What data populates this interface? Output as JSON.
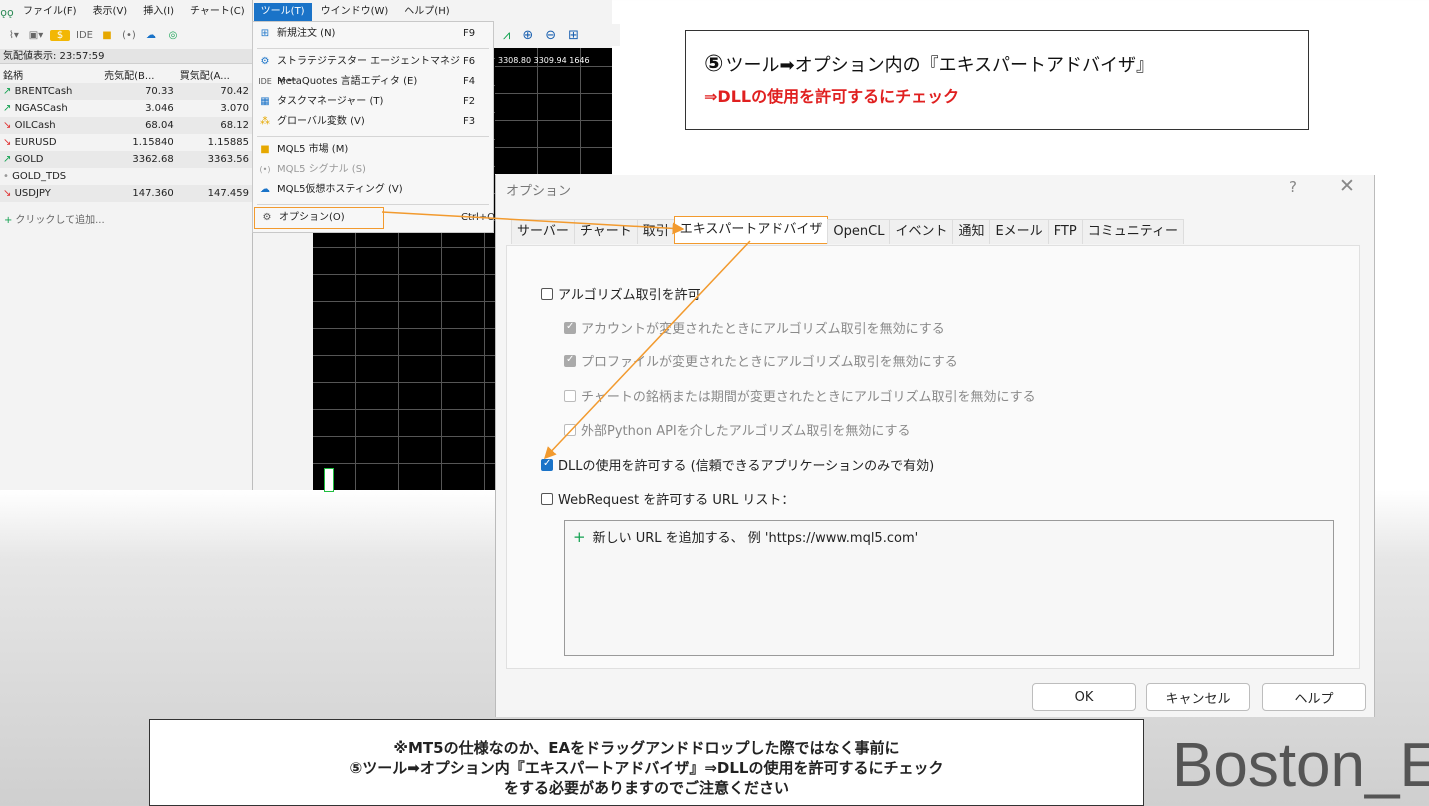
{
  "menubar": {
    "items": [
      "ファイル(F)",
      "表示(V)",
      "挿入(I)",
      "チャート(C)",
      "ツール(T)",
      "ウインドウ(W)",
      "ヘルプ(H)"
    ]
  },
  "toolbar": {
    "ide_label": "IDE"
  },
  "market_watch": {
    "header": "気配値表示: 23:57:59",
    "columns": [
      "銘柄",
      "売気配(B...",
      "買気配(A..."
    ],
    "rows": [
      {
        "trend": "up",
        "symbol": "BRENTCash",
        "bid": "70.33",
        "ask": "70.42"
      },
      {
        "trend": "up",
        "symbol": "NGASCash",
        "bid": "3.046",
        "ask": "3.070"
      },
      {
        "trend": "down",
        "symbol": "OILCash",
        "bid": "68.04",
        "ask": "68.12"
      },
      {
        "trend": "down",
        "symbol": "EURUSD",
        "bid": "1.15840",
        "ask": "1.15885"
      },
      {
        "trend": "up",
        "symbol": "GOLD",
        "bid": "3362.68",
        "ask": "3363.56"
      },
      {
        "trend": "neutral",
        "symbol": "GOLD_TDS",
        "bid": "",
        "ask": ""
      },
      {
        "trend": "down",
        "symbol": "USDJPY",
        "bid": "147.360",
        "ask": "147.459"
      }
    ],
    "add_label": "クリックして追加..."
  },
  "chart": {
    "price_text": "3308.80 3309.94 1646"
  },
  "tools_menu": {
    "items": [
      {
        "label": "新規注文 (N)",
        "key": "F9"
      },
      {
        "label": "ストラテジテスター エージェントマネジャー",
        "key": "F6"
      },
      {
        "label": "MetaQuotes 言語エディタ (E)",
        "key": "F4"
      },
      {
        "label": "タスクマネージャー (T)",
        "key": "F2"
      },
      {
        "label": "グローバル変数 (V)",
        "key": "F3"
      },
      {
        "label": "MQL5 市場 (M)",
        "key": ""
      },
      {
        "label": "MQL5 シグナル (S)",
        "key": ""
      },
      {
        "label": "MQL5仮想ホスティング (V)",
        "key": ""
      },
      {
        "label": "オプション(O)",
        "key": "Ctrl+O"
      }
    ]
  },
  "instruction": {
    "number": "⑤",
    "line1": "ツール➡オプション内の『エキスパートアドバイザ』",
    "line2": "⇒DLLの使用を許可するにチェック"
  },
  "dialog": {
    "title": "オプション",
    "help": "?",
    "close": "✕",
    "tabs": [
      "サーバー",
      "チャート",
      "取引",
      "エキスパートアドバイザ",
      "OpenCL",
      "イベント",
      "通知",
      "Eメール",
      "FTP",
      "コミュニティー"
    ],
    "active_tab": "エキスパートアドバイザ",
    "options": {
      "allow_algo": "アルゴリズム取引を許可",
      "disable_on_account": "アカウントが変更されたときにアルゴリズム取引を無効にする",
      "disable_on_profile": "プロファイルが変更されたときにアルゴリズム取引を無効にする",
      "disable_on_chart": "チャートの銘柄または期間が変更されたときにアルゴリズム取引を無効にする",
      "disable_python": "外部Python APIを介したアルゴリズム取引を無効にする",
      "allow_dll": "DLLの使用を許可する (信頼できるアプリケーションのみで有効)",
      "allow_webrequest": "WebRequest を許可する URL リスト："
    },
    "url_add_label": "新しい URL を追加する、 例 'https://www.mql5.com'",
    "buttons": {
      "ok": "OK",
      "cancel": "キャンセル",
      "help": "ヘルプ"
    }
  },
  "note": {
    "line1": "※MT5の仕様なのか、EAをドラッグアンドドロップした際ではなく事前に",
    "line2": "⑤ツール➡オプション内『エキスパートアドバイザ』⇒DLLの使用を許可するにチェック",
    "line3": "をする必要がありますのでご注意ください"
  },
  "brand": "Boston_EA",
  "colors": {
    "accent": "#1a73c8",
    "annotation": "#f29a2e",
    "warning_text": "#e02020"
  }
}
